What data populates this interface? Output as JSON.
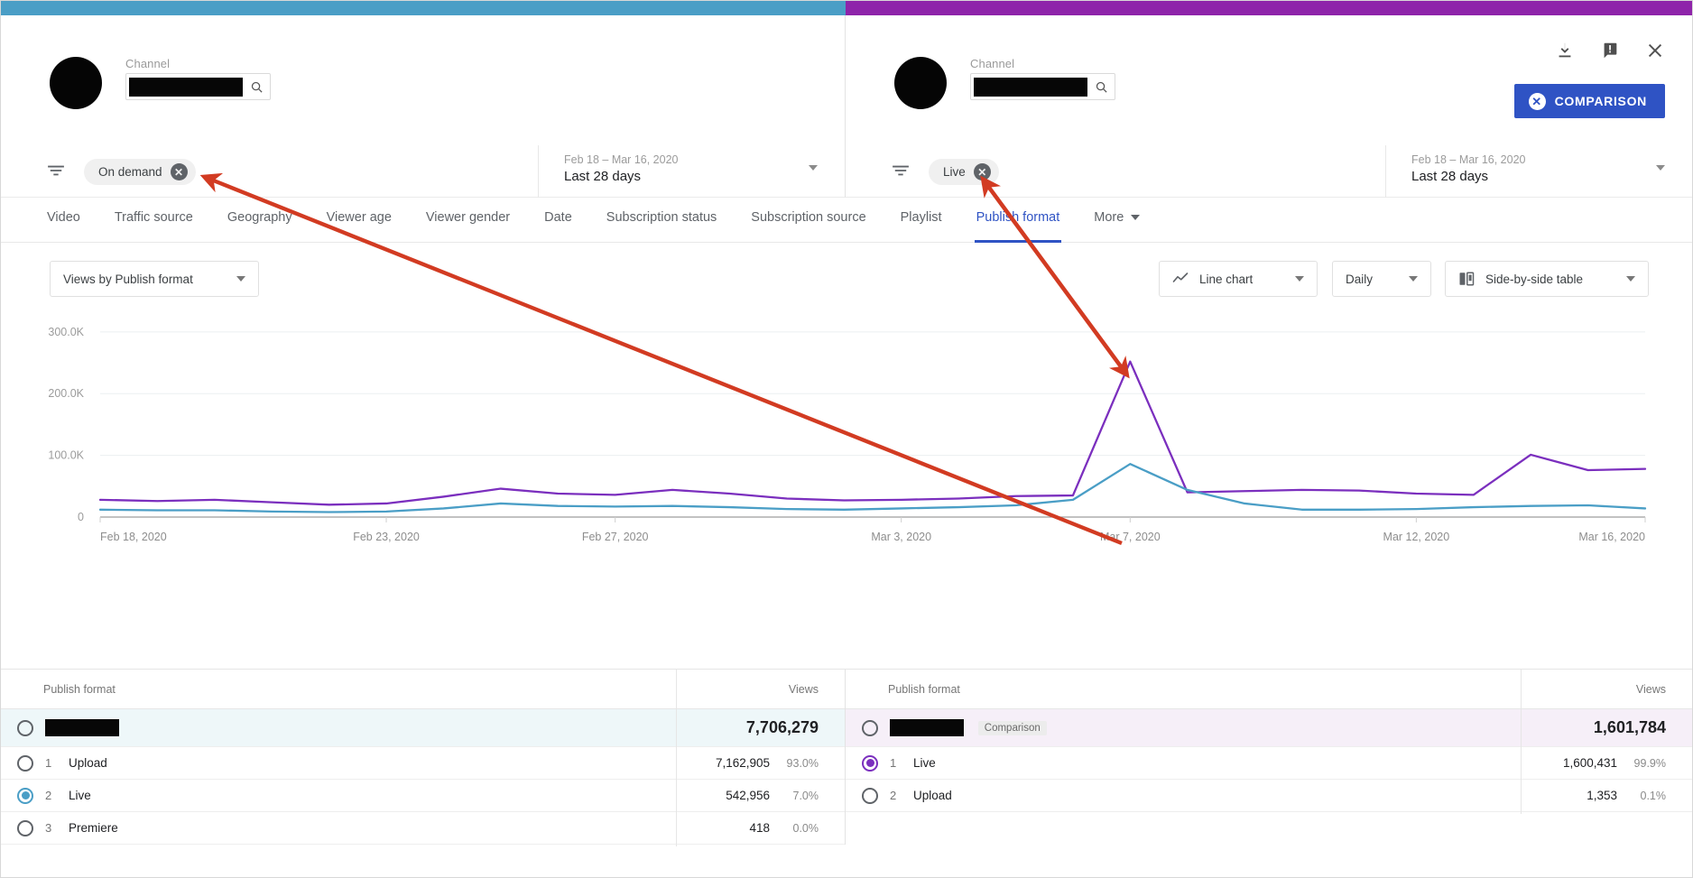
{
  "accent": {
    "left_color": "#4a9ec6",
    "right_color": "#8e24aa"
  },
  "panel_left": {
    "channel_label": "Channel",
    "search_placeholder": "",
    "filter_chip": "On demand",
    "date_range_sub": "Feb 18 – Mar 16, 2020",
    "date_range_main": "Last 28 days"
  },
  "panel_right": {
    "channel_label": "Channel",
    "search_placeholder": "",
    "filter_chip": "Live",
    "date_range_sub": "Feb 18 – Mar 16, 2020",
    "date_range_main": "Last 28 days",
    "comparison_button": "COMPARISON",
    "icons": {
      "download": "download-icon",
      "feedback": "feedback-icon",
      "close": "close-icon"
    }
  },
  "tabs": [
    {
      "label": "Video",
      "active": false
    },
    {
      "label": "Traffic source",
      "active": false
    },
    {
      "label": "Geography",
      "active": false
    },
    {
      "label": "Viewer age",
      "active": false
    },
    {
      "label": "Viewer gender",
      "active": false
    },
    {
      "label": "Date",
      "active": false
    },
    {
      "label": "Subscription status",
      "active": false
    },
    {
      "label": "Subscription source",
      "active": false
    },
    {
      "label": "Playlist",
      "active": false
    },
    {
      "label": "Publish format",
      "active": true
    },
    {
      "label": "More",
      "active": false
    }
  ],
  "controls": {
    "metric": "Views by Publish format",
    "chart_type": "Line chart",
    "granularity": "Daily",
    "table_type": "Side-by-side table"
  },
  "table_left": {
    "col_name": "Publish format",
    "col_views": "Views",
    "total": {
      "name_redacted": true,
      "views": "7,706,279"
    },
    "rows": [
      {
        "rank": "1",
        "name": "Upload",
        "views": "7,162,905",
        "pct": "93.0%",
        "selected": false
      },
      {
        "rank": "2",
        "name": "Live",
        "views": "542,956",
        "pct": "7.0%",
        "selected": true
      },
      {
        "rank": "3",
        "name": "Premiere",
        "views": "418",
        "pct": "0.0%",
        "selected": false
      }
    ]
  },
  "table_right": {
    "col_name": "Publish format",
    "col_views": "Views",
    "comparison_tag": "Comparison",
    "total": {
      "name_redacted": true,
      "views": "1,601,784"
    },
    "rows": [
      {
        "rank": "1",
        "name": "Live",
        "views": "1,600,431",
        "pct": "99.9%",
        "selected": true
      },
      {
        "rank": "2",
        "name": "Upload",
        "views": "1,353",
        "pct": "0.1%",
        "selected": false
      }
    ]
  },
  "annotations": {
    "arrow_color": "#d23b22",
    "arrow_1_target": "On demand filter chip",
    "arrow_1_source": "blue line peak near Mar 7, 2020",
    "arrow_2_target": "Live filter chip",
    "arrow_2_source": "purple line peak near Mar 7, 2020"
  },
  "chart_data": {
    "type": "line",
    "title": "",
    "xlabel": "",
    "ylabel": "Views",
    "ylim": [
      0,
      310000
    ],
    "yticks": [
      0,
      100000,
      200000,
      300000
    ],
    "ytick_labels": [
      "0",
      "100.0K",
      "200.0K",
      "300.0K"
    ],
    "grid": true,
    "legend_position": "none",
    "x": [
      "Feb 18, 2020",
      "Feb 19, 2020",
      "Feb 20, 2020",
      "Feb 21, 2020",
      "Feb 22, 2020",
      "Feb 23, 2020",
      "Feb 24, 2020",
      "Feb 25, 2020",
      "Feb 26, 2020",
      "Feb 27, 2020",
      "Feb 28, 2020",
      "Feb 29, 2020",
      "Mar 1, 2020",
      "Mar 2, 2020",
      "Mar 3, 2020",
      "Mar 4, 2020",
      "Mar 5, 2020",
      "Mar 6, 2020",
      "Mar 7, 2020",
      "Mar 8, 2020",
      "Mar 9, 2020",
      "Mar 10, 2020",
      "Mar 11, 2020",
      "Mar 12, 2020",
      "Mar 13, 2020",
      "Mar 14, 2020",
      "Mar 15, 2020",
      "Mar 16, 2020"
    ],
    "xtick_labels": [
      "Feb 18, 2020",
      "Feb 23, 2020",
      "Feb 27, 2020",
      "Mar 3, 2020",
      "Mar 7, 2020",
      "Mar 12, 2020",
      "Mar 16, 2020"
    ],
    "xtick_indices": [
      0,
      5,
      9,
      14,
      18,
      23,
      27
    ],
    "series": [
      {
        "name": "Live (comparison)",
        "color": "#7b2fbe",
        "values": [
          28000,
          26000,
          28000,
          24000,
          20000,
          22000,
          33000,
          46000,
          38000,
          36000,
          44000,
          38000,
          30000,
          27000,
          28000,
          30000,
          34000,
          35000,
          252000,
          40000,
          42000,
          44000,
          43000,
          38000,
          36000,
          101000,
          76000,
          78000
        ]
      },
      {
        "name": "On demand",
        "color": "#4a9ec6",
        "values": [
          12000,
          11000,
          11000,
          9000,
          8000,
          9000,
          14000,
          22000,
          18000,
          17000,
          18000,
          16000,
          13000,
          12000,
          14000,
          16000,
          19000,
          28000,
          86000,
          44000,
          22000,
          12000,
          12000,
          13000,
          16000,
          18000,
          19000,
          14000
        ]
      }
    ]
  }
}
